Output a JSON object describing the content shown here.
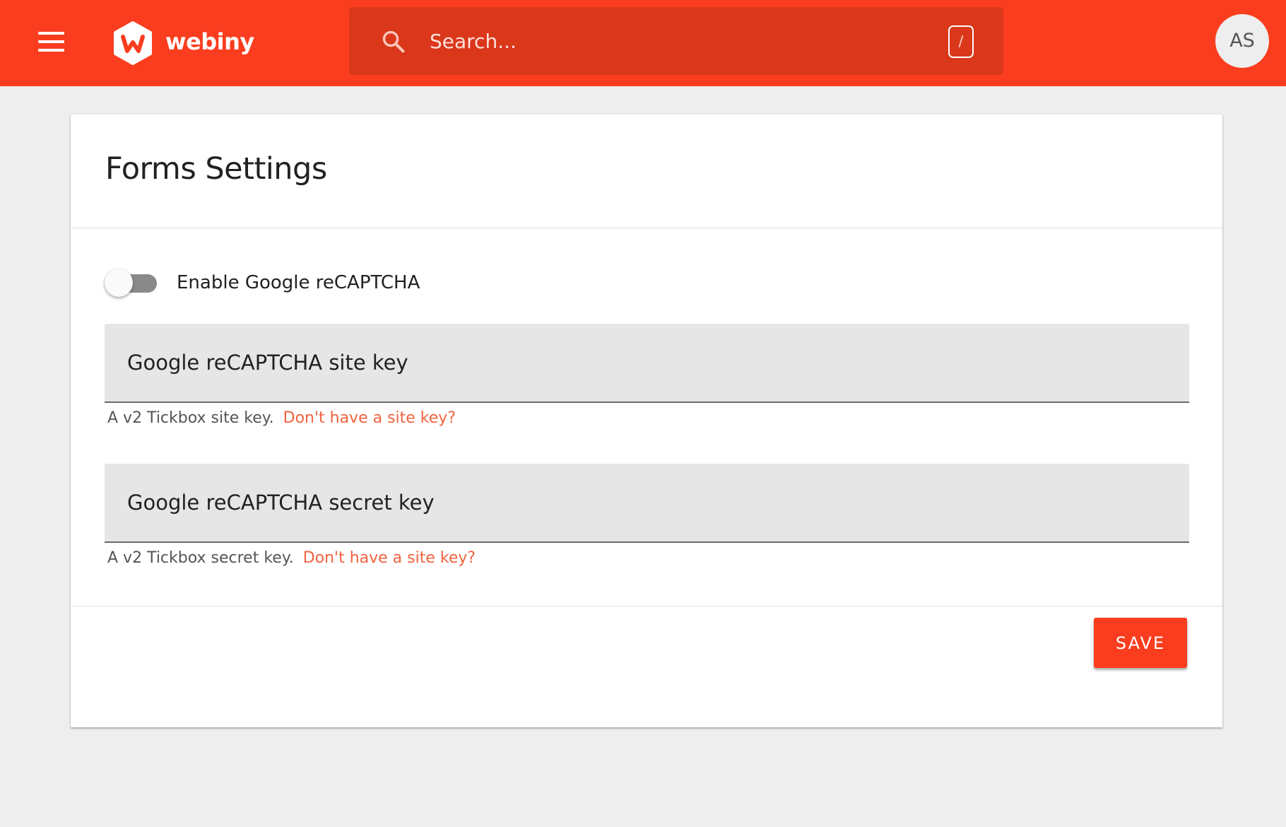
{
  "colors": {
    "brand": "#fa3d1e",
    "search_bg": "#da371b",
    "link": "#f0633f",
    "page_bg": "#eeeeee"
  },
  "topbar": {
    "menu_icon": "hamburger-menu-icon",
    "logo_text": "webiny",
    "search": {
      "placeholder": "Search...",
      "shortcut": "/",
      "icon": "search-icon"
    },
    "avatar_initials": "AS"
  },
  "card": {
    "title": "Forms Settings",
    "recaptcha_toggle": {
      "label": "Enable Google reCAPTCHA",
      "enabled": false
    },
    "site_key": {
      "label": "Google reCAPTCHA site key",
      "value": "",
      "helper": "A v2 Tickbox site key.",
      "helper_link": "Don't have a site key?"
    },
    "secret_key": {
      "label": "Google reCAPTCHA secret key",
      "value": "",
      "helper": "A v2 Tickbox secret key.",
      "helper_link": "Don't have a site key?"
    },
    "save_label": "SAVE"
  }
}
